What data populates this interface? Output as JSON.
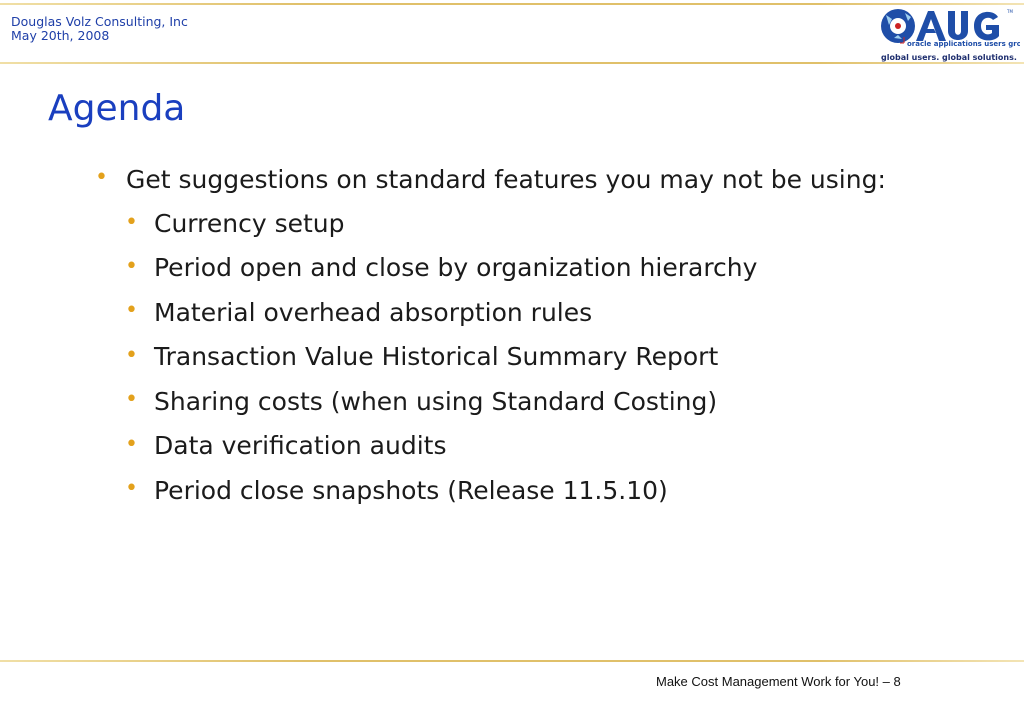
{
  "header": {
    "company": "Douglas Volz Consulting, Inc",
    "date": "May 20th, 2008"
  },
  "logo": {
    "name": "OAUG",
    "tagline_top": "oracle applications users group",
    "tagline_bottom": "global users. global solutions."
  },
  "slide": {
    "title": "Agenda",
    "main_bullet": "Get suggestions on standard features you may not be using:",
    "sub_bullets": [
      "Currency setup",
      "Period open and close by organization hierarchy",
      "Material overhead absorption rules",
      "Transaction Value Historical Summary Report",
      "Sharing costs (when using Standard Costing)",
      "Data verification audits",
      "Period close snapshots (Release 11.5.10)"
    ]
  },
  "footer": {
    "text": "Make Cost Management Work for You! – 8"
  },
  "colors": {
    "title": "#1a3fbf",
    "header_text": "#1f3fa8",
    "bullet": "#e3a11c",
    "rule": "#e0c06a"
  }
}
